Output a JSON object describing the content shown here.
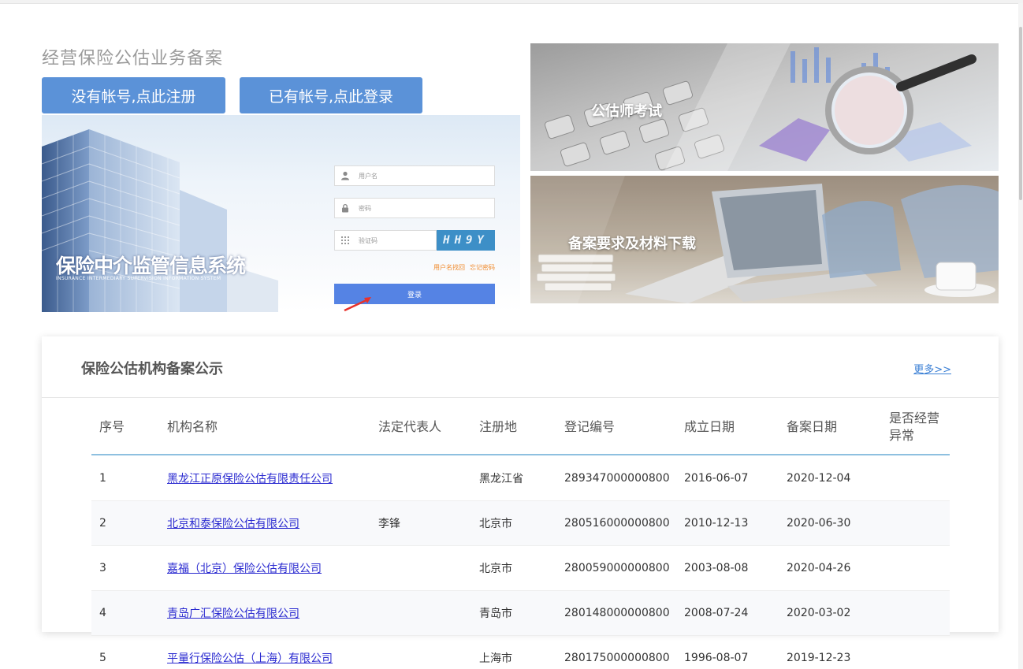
{
  "page": {
    "title": "经营保险公估业务备案"
  },
  "actions": {
    "register_label": "没有帐号,点此注册",
    "login_label": "已有帐号,点此登录"
  },
  "banner": {
    "system_name": "保险中介监管信息系统",
    "system_name_en": "INSURANCE INTERMEDIARY SUPERVISION INFORMATION SYSTEM",
    "login_form": {
      "username_placeholder": "用户名",
      "password_placeholder": "密码",
      "captcha_placeholder": "验证码",
      "captcha_text": "HH9Y",
      "find_username": "用户名找回",
      "forgot_password": "忘记密码",
      "submit_label": "登录"
    }
  },
  "tiles": [
    {
      "label": "公估师考试"
    },
    {
      "label": "备案要求及材料下载"
    }
  ],
  "notice": {
    "title": "保险公估机构备案公示",
    "more_label": "更多>>",
    "columns": [
      "序号",
      "机构名称",
      "法定代表人",
      "注册地",
      "登记编号",
      "成立日期",
      "备案日期",
      "是否经营异常"
    ],
    "rows": [
      {
        "no": "1",
        "name": "黑龙江正原保险公估有限责任公司",
        "rep": "",
        "region": "黑龙江省",
        "reg_no": "289347000000800",
        "founded": "2016-06-07",
        "filed": "2020-12-04",
        "abnormal": ""
      },
      {
        "no": "2",
        "name": "北京和泰保险公估有限公司",
        "rep": "李锋",
        "region": "北京市",
        "reg_no": "280516000000800",
        "founded": "2010-12-13",
        "filed": "2020-06-30",
        "abnormal": ""
      },
      {
        "no": "3",
        "name": "嘉福（北京）保险公估有限公司",
        "rep": "",
        "region": "北京市",
        "reg_no": "280059000000800",
        "founded": "2003-08-08",
        "filed": "2020-04-26",
        "abnormal": ""
      },
      {
        "no": "4",
        "name": "青岛广汇保险公估有限公司",
        "rep": "",
        "region": "青岛市",
        "reg_no": "280148000000800",
        "founded": "2008-07-24",
        "filed": "2020-03-02",
        "abnormal": ""
      },
      {
        "no": "5",
        "name": "平量行保险公估（上海）有限公司",
        "rep": "",
        "region": "上海市",
        "reg_no": "280175000000800",
        "founded": "1996-08-07",
        "filed": "2019-12-23",
        "abnormal": ""
      }
    ]
  },
  "colors": {
    "primary_button": "#5b92d8",
    "login_button": "#5583e4",
    "link": "#2a2ad0",
    "more_link": "#3a7fd5",
    "header_rule": "#8ec0e0",
    "orange_link": "#f08a2b"
  }
}
